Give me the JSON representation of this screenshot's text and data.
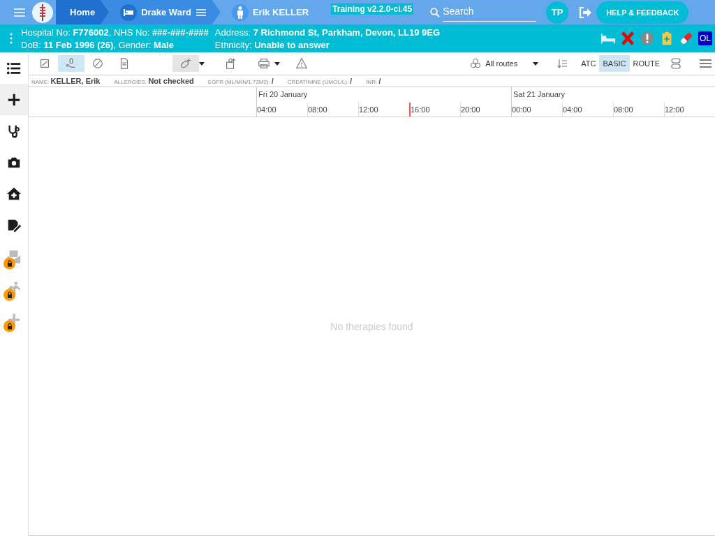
{
  "top_bar": {
    "crumbs": [
      {
        "kind": "home",
        "label": "Home"
      },
      {
        "kind": "ward",
        "label": "Drake Ward"
      },
      {
        "kind": "patient",
        "label": "Erik KELLER"
      }
    ],
    "version": "Training v2.2.0-ci.45",
    "search": {
      "placeholder": "Search"
    },
    "user_initials": "TP",
    "help_button": "HELP & FEEDBACK"
  },
  "patient_banner": {
    "left": [
      [
        {
          "label": "Hospital No: ",
          "value": "F776002"
        },
        {
          "label": ", NHS No: ",
          "value": "###-###-####"
        }
      ],
      [
        {
          "label": "DoB: ",
          "value": "11 Feb 1996 (26)"
        },
        {
          "label": ", Gender: ",
          "value": "Male"
        }
      ]
    ],
    "right": [
      [
        {
          "label": "Address: ",
          "value": "7 Richmond St, Parkham, Devon, LL19 9EG"
        }
      ],
      [
        {
          "label": "Ethnicity: ",
          "value": "Unable to answer"
        }
      ]
    ],
    "status_badge": "OL"
  },
  "sidebar": {
    "items": [
      {
        "kind": "list",
        "selected": false,
        "locked": false
      },
      {
        "kind": "plus",
        "selected": true,
        "locked": false
      },
      {
        "kind": "stethoscope",
        "selected": false,
        "locked": false
      },
      {
        "kind": "camera",
        "selected": false,
        "locked": false
      },
      {
        "kind": "house",
        "selected": false,
        "locked": false
      },
      {
        "kind": "note",
        "selected": false,
        "locked": false
      },
      {
        "kind": "mail",
        "selected": false,
        "locked": true
      },
      {
        "kind": "walk",
        "selected": false,
        "locked": true
      },
      {
        "kind": "plus",
        "selected": false,
        "locked": true
      }
    ]
  },
  "toolbar": {
    "views": [
      {
        "kind": "chart",
        "selected": false
      },
      {
        "kind": "hand",
        "selected": true
      },
      {
        "kind": "pill",
        "selected": false
      },
      {
        "kind": "doc",
        "selected": false
      }
    ],
    "route_filter": "All routes",
    "modes": [
      {
        "label": "ATC",
        "selected": false
      },
      {
        "label": "BASIC",
        "selected": true
      },
      {
        "label": "ROUTE",
        "selected": false
      }
    ]
  },
  "info_strip": [
    {
      "label": "NAME: ",
      "value": "KELLER, Erik",
      "big": true
    },
    {
      "label": "ALLERGIES: ",
      "value": "Not checked",
      "big": true
    },
    {
      "label": "EGFR (ML/MIN/1.73M2): ",
      "value": "/",
      "big": false
    },
    {
      "label": "CREATININE (UMOL/L): ",
      "value": "/",
      "big": false
    },
    {
      "label": "INR: ",
      "value": "/",
      "big": false
    }
  ],
  "timeline": {
    "days": [
      {
        "label": "Fri 20 January",
        "hours": [
          {
            "label": "04:00",
            "now": false
          },
          {
            "label": "08:00",
            "now": false
          },
          {
            "label": "12:00",
            "now": false
          },
          {
            "label": "16:00",
            "now": true
          },
          {
            "label": "20:00",
            "now": false
          }
        ]
      },
      {
        "label": "Sat 21 January",
        "hours": [
          {
            "label": "00:00",
            "now": false
          },
          {
            "label": "04:00",
            "now": false
          },
          {
            "label": "08:00",
            "now": false
          },
          {
            "label": "12:00",
            "now": false
          }
        ]
      }
    ]
  },
  "empty_message": "No therapies found"
}
